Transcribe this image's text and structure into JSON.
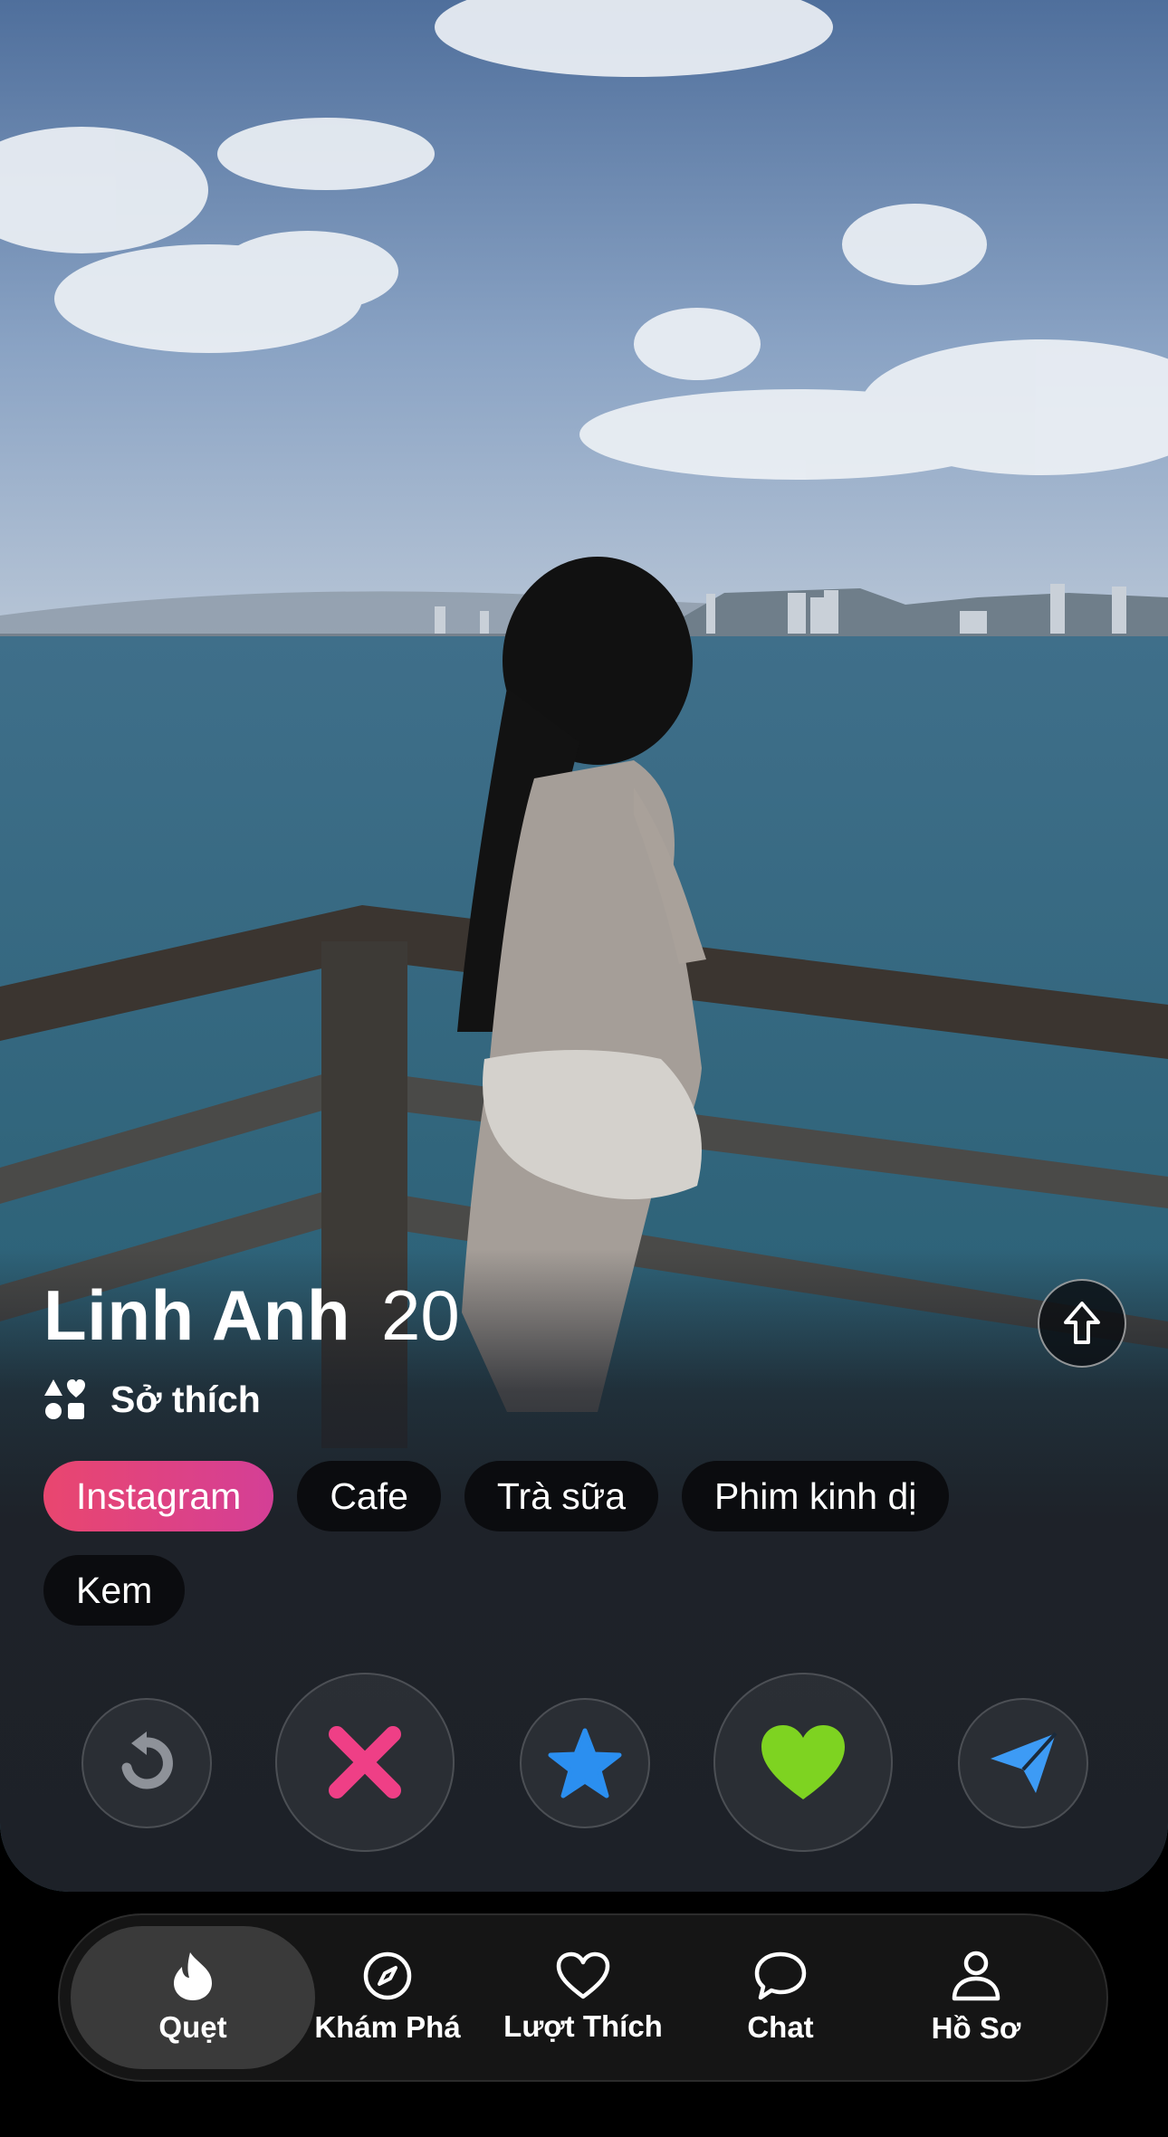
{
  "profile": {
    "name": "Linh Anh",
    "age": "20",
    "interests_label": "Sở thích",
    "interests": [
      "Instagram",
      "Cafe",
      "Trà sữa",
      "Phim kinh dị",
      "Kem"
    ],
    "active_interest": "Instagram"
  },
  "actions": [
    {
      "name": "rewind",
      "icon": "rewind-icon"
    },
    {
      "name": "nope",
      "icon": "close-x-icon"
    },
    {
      "name": "super-like",
      "icon": "star-icon"
    },
    {
      "name": "like",
      "icon": "heart-icon"
    },
    {
      "name": "boost",
      "icon": "paper-plane-icon"
    }
  ],
  "nav": {
    "items": [
      {
        "label": "Quẹt",
        "icon": "flame-icon",
        "active": true
      },
      {
        "label": "Khám Phá",
        "icon": "compass-icon",
        "active": false
      },
      {
        "label": "Lượt Thích",
        "icon": "heart-outline-icon",
        "active": false
      },
      {
        "label": "Chat",
        "icon": "chat-bubble-icon",
        "active": false
      },
      {
        "label": "Hồ Sơ",
        "icon": "user-icon",
        "active": false
      }
    ]
  },
  "colors": {
    "accent_pink": "#e9466f",
    "like_green": "#7ed321",
    "nope_pink": "#ef3f86",
    "star_blue": "#2b8ff0",
    "boost_blue": "#3d9bf5"
  }
}
